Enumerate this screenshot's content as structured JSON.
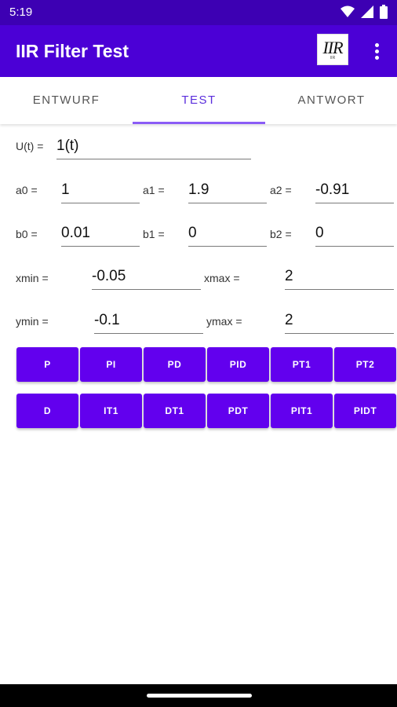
{
  "status": {
    "time": "5:19"
  },
  "app": {
    "title": "IIR Filter Test",
    "logo_text": "IIR",
    "logo_small": "IIR"
  },
  "tabs": [
    {
      "label": "ENTWURF"
    },
    {
      "label": "TEST"
    },
    {
      "label": "ANTWORT"
    }
  ],
  "form": {
    "u": {
      "label": "U(t) =",
      "value": "1(t)"
    },
    "a0": {
      "label": "a0 =",
      "value": "1"
    },
    "a1": {
      "label": "a1 =",
      "value": "1.9"
    },
    "a2": {
      "label": "a2 =",
      "value": "-0.91"
    },
    "b0": {
      "label": "b0 =",
      "value": "0.01"
    },
    "b1": {
      "label": "b1 =",
      "value": "0"
    },
    "b2": {
      "label": "b2 =",
      "value": "0"
    },
    "xmin": {
      "label": "xmin =",
      "value": "-0.05"
    },
    "xmax": {
      "label": "xmax =",
      "value": "2"
    },
    "ymin": {
      "label": "ymin =",
      "value": "-0.1"
    },
    "ymax": {
      "label": "ymax =",
      "value": "2"
    }
  },
  "buttons_row1": [
    "P",
    "PI",
    "PD",
    "PID",
    "PT1",
    "PT2"
  ],
  "buttons_row2": [
    "D",
    "IT1",
    "DT1",
    "PDT",
    "PIT1",
    "PIDT"
  ],
  "colors": {
    "status_bar": "#3d00b3",
    "app_bar": "#4b00d6",
    "button": "#6200ee",
    "tab_active": "#5a2ddc"
  }
}
